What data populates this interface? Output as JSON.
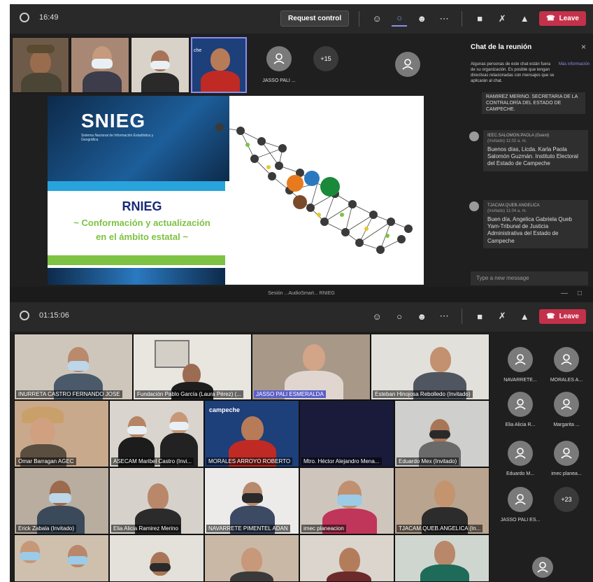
{
  "top": {
    "timer": "16:49",
    "request_control": "Request control",
    "leave": "Leave",
    "tiles": [
      {
        "name": ""
      },
      {
        "name": ""
      },
      {
        "name": ""
      },
      {
        "name": ""
      }
    ],
    "avatar_name": "JASSO PALI ...",
    "overflow": "+15",
    "chat": {
      "title": "Chat de la reunión",
      "notice": "Algunas personas de este chat están fuera de su organización. Es posible que tengan directivas relacionadas con mensajes que se aplicarán al chat.",
      "notice_link": "Más información",
      "prev_tail": "RAMIREZ MERINO. SECRETARIA DE LA CONTRALORÍA DEL ESTADO DE CAMPECHE.",
      "messages": [
        {
          "author": "IEEC.SALOMON.PAOLA (Guest)",
          "tag": "(Invitado)",
          "time": "11:02 a. m.",
          "text": "Buenos días, Licda. Karla Paola Salomón Guzmán. Instituto Electoral del Estado de Campeche"
        },
        {
          "author": "TJACAM.QUEB.ANGELICA",
          "tag": "(Invitado)",
          "time": "11:04 a. m.",
          "text": "Buen día, Angelica Gabriela Queb Yam-Tribunal de Justicia Administrativa del Estado de Campeche"
        }
      ],
      "input_placeholder": "Type a new message"
    },
    "slide": {
      "logo": "SNIEG",
      "logo_sub": "Sistema Nacional de Información Estadística y Geográfica",
      "title": "RNIEG",
      "subtitle1": "~ Conformación y actualización",
      "subtitle2": "en el ámbito estatal ~"
    }
  },
  "bottom": {
    "window_title": "Sesión ...AudioSmart... RNIEG",
    "timer": "01:15:06",
    "leave": "Leave",
    "tiles": [
      "INURRETA CASTRO FERNANDO JOSE",
      "Fundación Pablo García (Laura Pérez) (...",
      "JASSO PALI ESMERALDA",
      "Esteban Hinojosa Rebolledo (Invitado)",
      "Omar Barragan AGEC",
      "ASECAM Maribel Castro (Invi...",
      "MORALES ARROYO ROBERTO",
      "Mtro. Héctor Alejandro Mena...",
      "Eduardo Mex (Invitado)",
      "Erick Zabala (Invitado)",
      "Elia Alicia Ramirez Merino",
      "NAVARRETE PIMENTEL ADAN",
      "imec planeacion",
      "TJACAM.QUEB.ANGELICA (In..."
    ],
    "side_people": [
      "NAVARRETE...",
      "MORALES A...",
      "Elia Alicia R...",
      "Margarita ...",
      "Eduardo M...",
      "imec planea...",
      "JASSO PALI ES..."
    ],
    "overflow": "+23",
    "campeche_banner": "campeche"
  },
  "colors": {
    "teams_purple": "#8b8cf0",
    "leave_red": "#c4314b",
    "slide_blue": "#29a3dc",
    "slide_green": "#7dc242",
    "slide_title": "#1a2a7a"
  }
}
